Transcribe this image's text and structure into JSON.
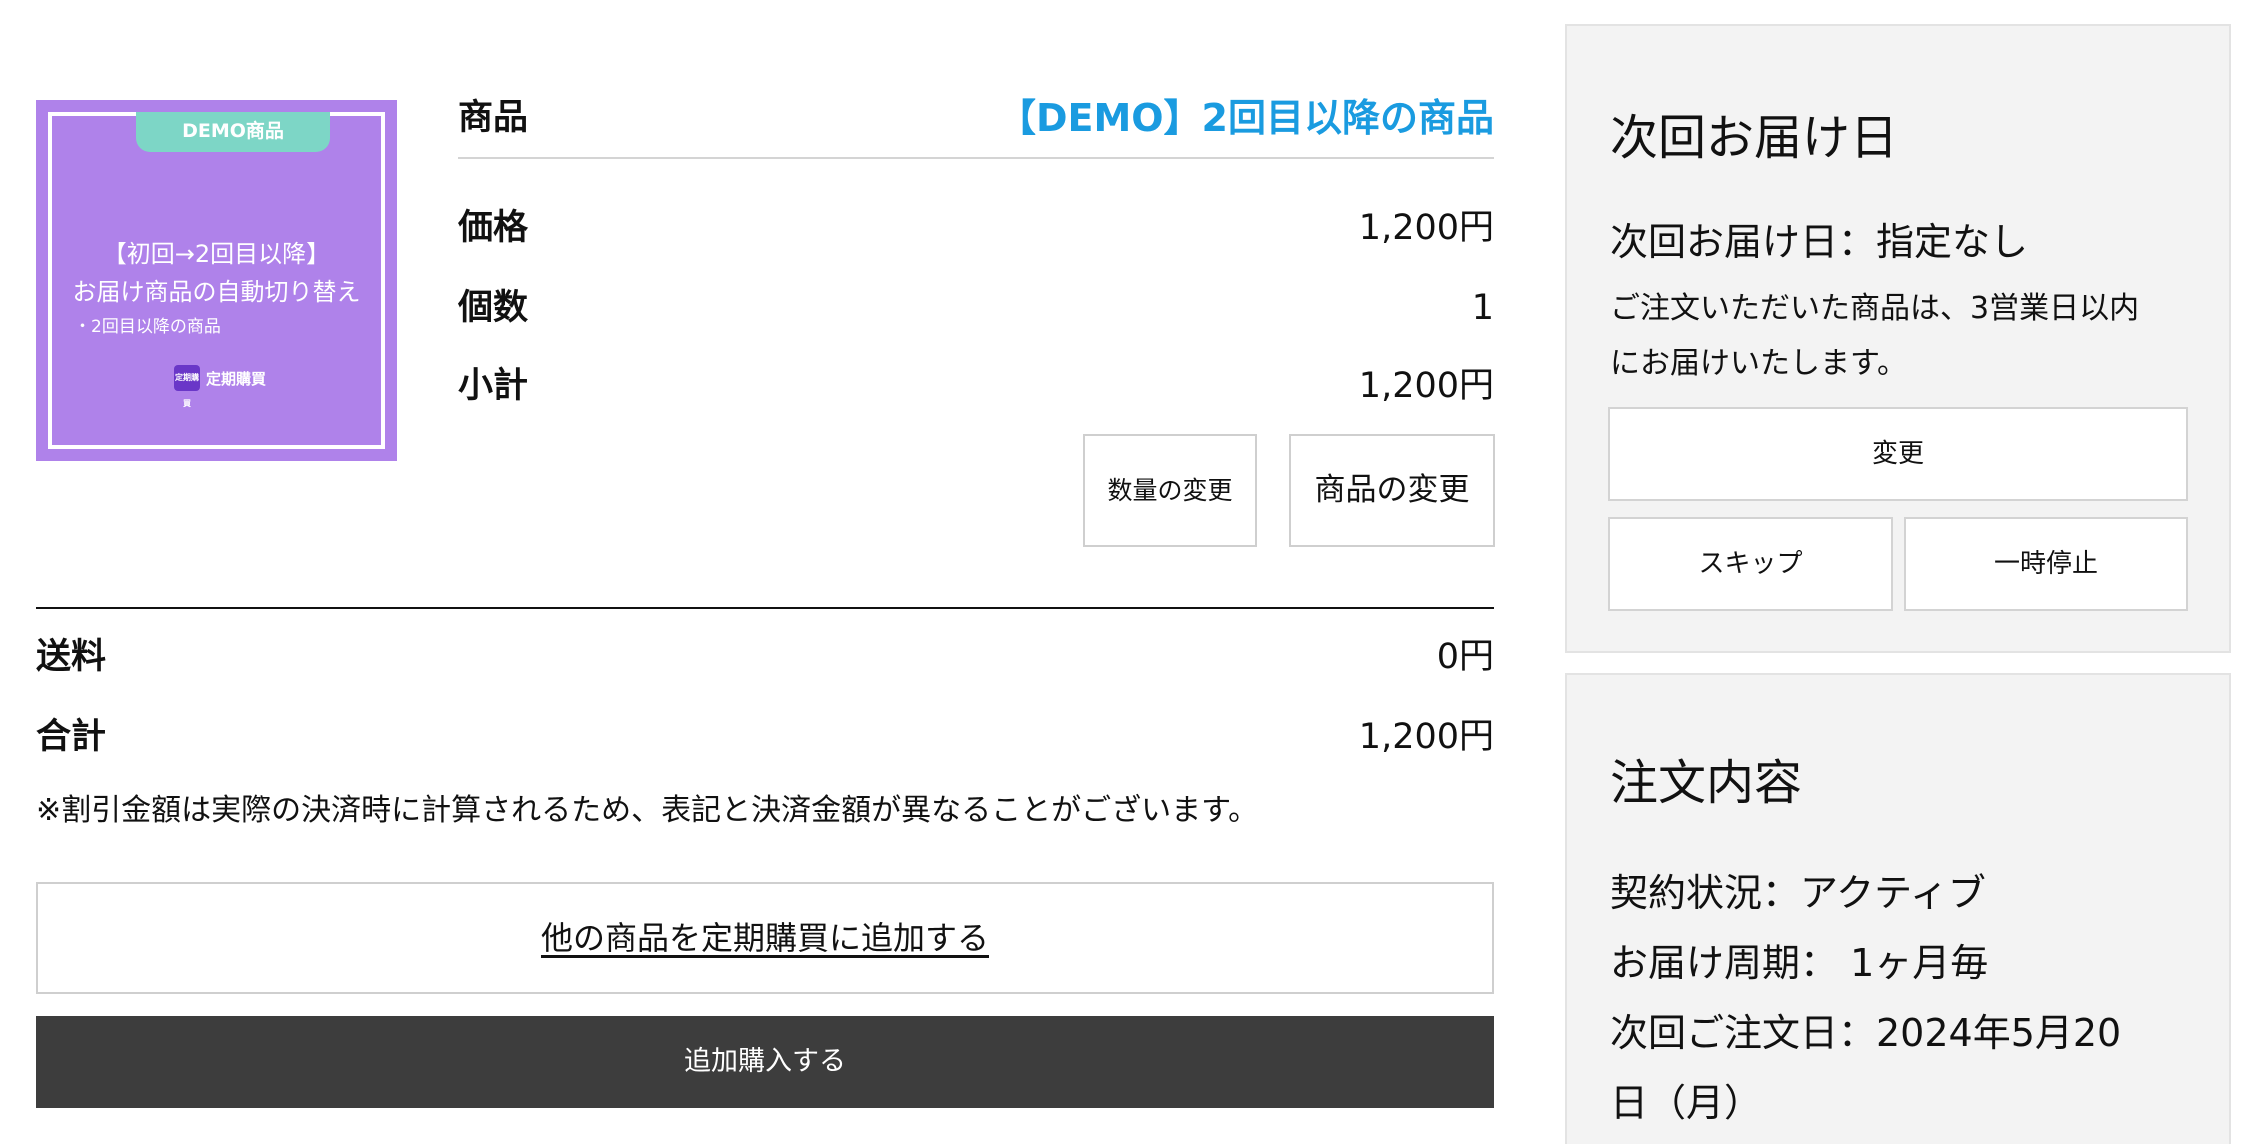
{
  "product": {
    "image": {
      "tag": "DEMO商品",
      "line1": "【初回→2回目以降】",
      "line2": "お届け商品の自動切り替え",
      "line3": "・2回目以降の商品",
      "logo_box_text": "定期購買",
      "logo_text": "定期購買"
    },
    "name_label": "商品",
    "name_value": "【DEMO】2回目以降の商品",
    "price_label": "価格",
    "price_value": "1,200円",
    "qty_label": "個数",
    "qty_value": "1",
    "subtotal_label": "小計",
    "subtotal_value": "1,200円",
    "change_qty_button": "数量の変更",
    "change_product_button": "商品の変更"
  },
  "summary": {
    "shipping_label": "送料",
    "shipping_value": "0円",
    "total_label": "合計",
    "total_value": "1,200円",
    "note": "※割引金額は実際の決済時に計算されるため、表記と決済金額が異なることがございます。"
  },
  "actions": {
    "add_other_link": "他の商品を定期購買に追加する",
    "buy_button": "追加購入する"
  },
  "delivery_panel": {
    "title": "次回お届け日",
    "next_date": "次回お届け日：指定なし",
    "info_line1": "ご注文いただいた商品は、3営業日以内",
    "info_line2": "にお届けいたします。",
    "change_button": "変更",
    "skip_button": "スキップ",
    "pause_button": "一時停止"
  },
  "order_panel": {
    "title": "注文内容",
    "status": "契約状況：アクティブ",
    "cycle": "お届け周期： 1ヶ月毎",
    "next_order_line1": "次回ご注文日：2024年5月20",
    "next_order_line2": "日（月）"
  },
  "colors": {
    "link_blue": "#1a9be0",
    "product_purple": "#af82ea",
    "tag_teal": "#7dd6c6",
    "dark_button": "#3d3d3d",
    "panel_bg": "#f3f3f3"
  }
}
